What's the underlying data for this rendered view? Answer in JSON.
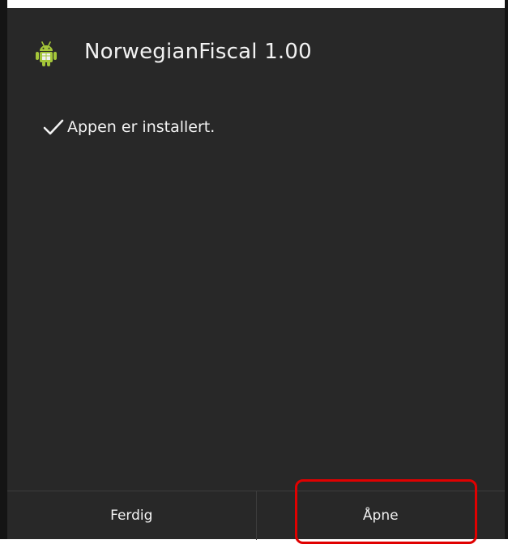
{
  "dialog": {
    "app_icon": "android-robot-icon",
    "title": "NorwegianFiscal 1.00",
    "status_icon": "checkmark-icon",
    "status_text": "Appen er installert."
  },
  "buttons": {
    "done_label": "Ferdig",
    "open_label": "Åpne"
  },
  "colors": {
    "background": "#282828",
    "text": "#f2f2f2",
    "icon_green": "#a4c639",
    "highlight": "#e00000"
  }
}
